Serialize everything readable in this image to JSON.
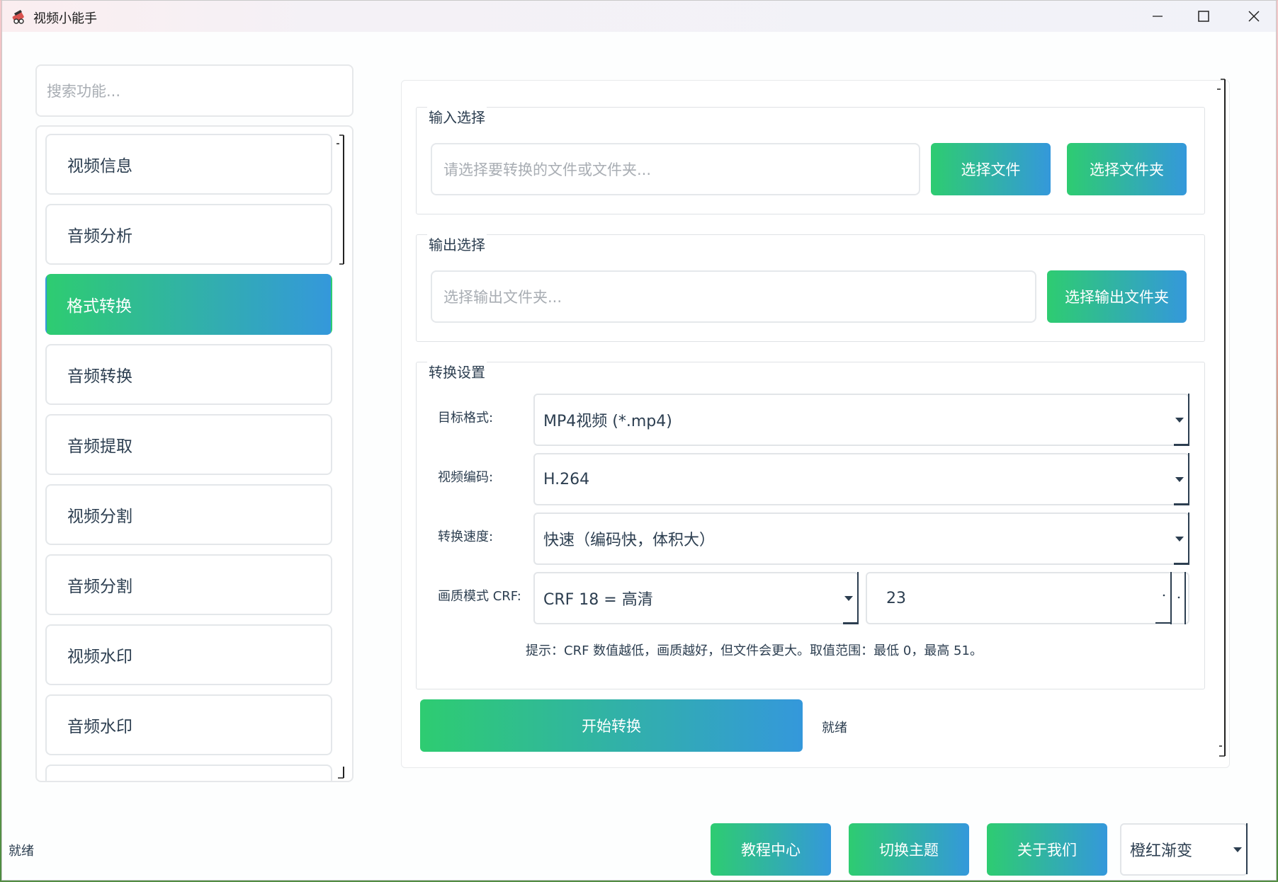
{
  "window": {
    "title": "视频小能手"
  },
  "sidebar": {
    "search_placeholder": "搜索功能...",
    "items": [
      {
        "label": "视频信息",
        "active": false
      },
      {
        "label": "音频分析",
        "active": false
      },
      {
        "label": "格式转换",
        "active": true
      },
      {
        "label": "音频转换",
        "active": false
      },
      {
        "label": "音频提取",
        "active": false
      },
      {
        "label": "视频分割",
        "active": false
      },
      {
        "label": "音频分割",
        "active": false
      },
      {
        "label": "视频水印",
        "active": false
      },
      {
        "label": "音频水印",
        "active": false
      }
    ]
  },
  "input_group": {
    "title": "输入选择",
    "placeholder": "请选择要转换的文件或文件夹...",
    "select_file_label": "选择文件",
    "select_folder_label": "选择文件夹"
  },
  "output_group": {
    "title": "输出选择",
    "placeholder": "选择输出文件夹...",
    "select_output_label": "选择输出文件夹"
  },
  "settings_group": {
    "title": "转换设置",
    "target_format_label": "目标格式:",
    "target_format_value": "MP4视频 (*.mp4)",
    "video_codec_label": "视频编码:",
    "video_codec_value": "H.264",
    "speed_label": "转换速度:",
    "speed_value": "快速（编码快，体积大）",
    "crf_label": "画质模式 CRF:",
    "crf_mode_value": "CRF 18 = 高清",
    "crf_number": "23",
    "hint": "提示：CRF 数值越低，画质越好，但文件会更大。取值范围：最低 0，最高 51。"
  },
  "action": {
    "start_label": "开始转换",
    "status": "就绪"
  },
  "bottom_bar": {
    "status": "就绪",
    "tutorial_label": "教程中心",
    "switch_theme_label": "切换主题",
    "about_label": "关于我们",
    "theme_value": "橙红渐变"
  },
  "colors": {
    "gradient_start": "#2ecc71",
    "gradient_end": "#3498db",
    "text": "#2c3e50"
  }
}
